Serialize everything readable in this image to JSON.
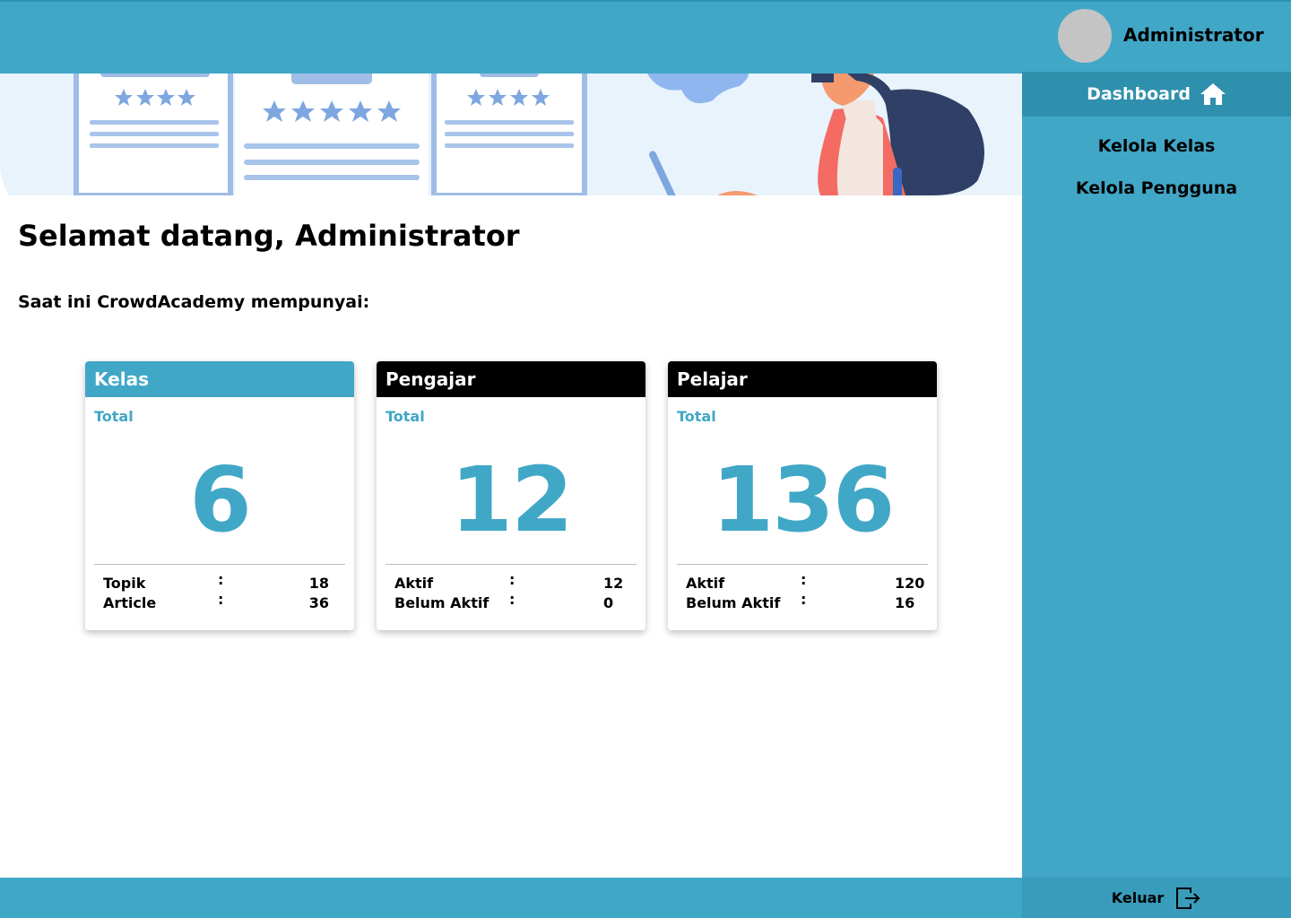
{
  "header": {
    "user_name": "Administrator"
  },
  "sidebar": {
    "items": [
      {
        "label": "Dashboard",
        "active": true,
        "icon": "home-icon"
      },
      {
        "label": "Kelola Kelas",
        "active": false
      },
      {
        "label": "Kelola Pengguna",
        "active": false
      }
    ],
    "logout_label": "Keluar",
    "logout_icon": "logout-icon"
  },
  "main": {
    "welcome": "Selamat datang, Administrator",
    "subtitle": "Saat ini CrowdAcademy mempunyai:",
    "cards": [
      {
        "title": "Kelas",
        "header_color": "#41a7c7",
        "total_label": "Total",
        "total": "6",
        "stats": [
          {
            "label": "Topik",
            "value": "18"
          },
          {
            "label": "Article",
            "value": "36"
          }
        ]
      },
      {
        "title": "Pengajar",
        "header_color": "#000000",
        "total_label": "Total",
        "total": "12",
        "stats": [
          {
            "label": "Aktif",
            "value": "12"
          },
          {
            "label": "Belum Aktif",
            "value": "0"
          }
        ]
      },
      {
        "title": "Pelajar",
        "header_color": "#000000",
        "total_label": "Total",
        "total": "136",
        "stats": [
          {
            "label": "Aktif",
            "value": "120"
          },
          {
            "label": "Belum Aktif",
            "value": "16"
          }
        ]
      }
    ]
  },
  "colors": {
    "accent": "#41a7c7",
    "accent_dark": "#2f90ad"
  }
}
